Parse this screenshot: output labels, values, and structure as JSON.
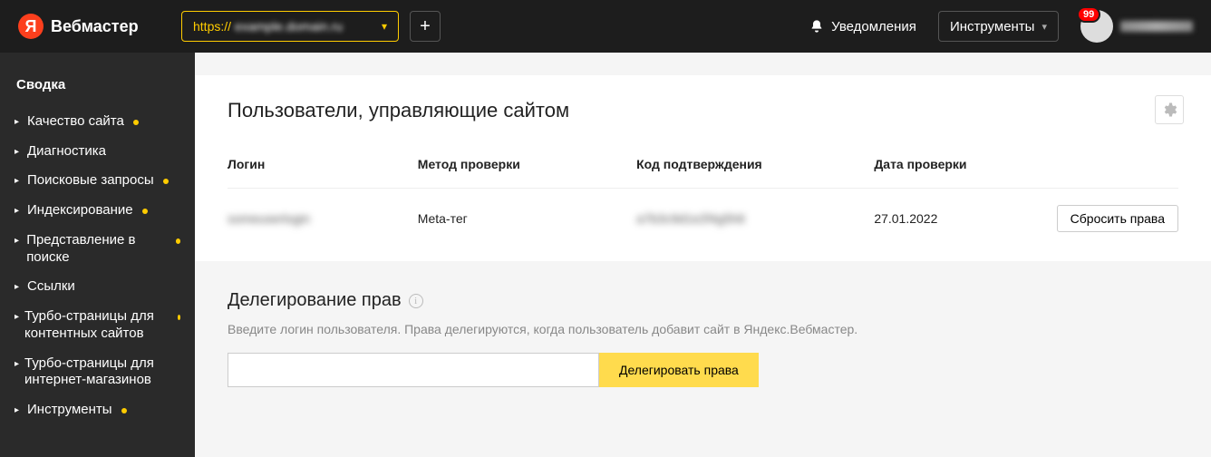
{
  "header": {
    "brand": "Вебмастер",
    "site_url_prefix": "https://",
    "site_url_blurred": "example.domain.ru",
    "notifications_label": "Уведомления",
    "tools_label": "Инструменты",
    "badge_count": "99"
  },
  "sidebar": {
    "summary_label": "Сводка",
    "items": [
      {
        "label": "Качество сайта",
        "caret": true,
        "dot": true
      },
      {
        "label": "Диагностика",
        "caret": true,
        "dot": false
      },
      {
        "label": "Поисковые запросы",
        "caret": true,
        "dot": true
      },
      {
        "label": "Индексирование",
        "caret": true,
        "dot": true
      },
      {
        "label": "Представление в поиске",
        "caret": true,
        "dot": true
      },
      {
        "label": "Ссылки",
        "caret": true,
        "dot": false
      },
      {
        "label": "Турбо-страницы для контентных сайтов",
        "caret": true,
        "dot": true
      },
      {
        "label": "Турбо-страницы для интернет-магазинов",
        "caret": true,
        "dot": false
      },
      {
        "label": "Инструменты",
        "caret": true,
        "dot": true
      }
    ]
  },
  "users_card": {
    "title": "Пользователи, управляющие сайтом",
    "columns": {
      "login": "Логин",
      "method": "Метод проверки",
      "code": "Код подтверждения",
      "date": "Дата проверки"
    },
    "row": {
      "login_blurred": "someuserlogin",
      "method": "Meta-тег",
      "code_blurred": "a7b3c9d1e2f4g5h6",
      "date": "27.01.2022",
      "reset_label": "Сбросить права"
    }
  },
  "delegation": {
    "title": "Делегирование прав",
    "hint": "Введите логин пользователя. Права делегируются, когда пользователь добавит сайт в Яндекс.Вебмастер.",
    "input_placeholder": "",
    "button_label": "Делегировать права"
  }
}
